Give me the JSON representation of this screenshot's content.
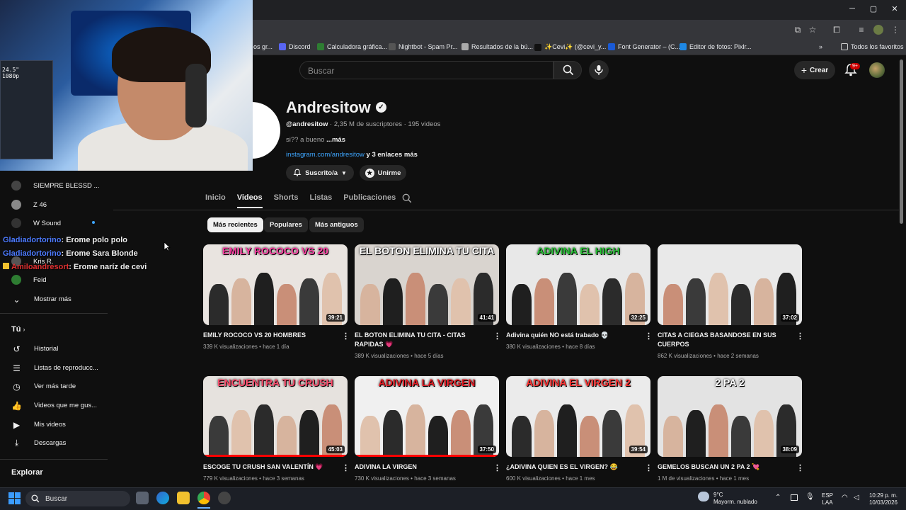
{
  "browser": {
    "bookmarks": [
      {
        "label": "os gr...",
        "color": "#888888"
      },
      {
        "label": "Discord",
        "color": "#5865f2"
      },
      {
        "label": "Calculadora gráfica...",
        "color": "#2e7d32"
      },
      {
        "label": "Nightbot - Spam Pr...",
        "color": "#555555"
      },
      {
        "label": "Resultados de la bú...",
        "color": "#aaaaaa"
      },
      {
        "label": "✨Cevi✨ (@cevi_y...",
        "color": "#111111"
      },
      {
        "label": "Font Generator – (C...",
        "color": "#1a5ad6"
      },
      {
        "label": "Editor de fotos: Pixlr...",
        "color": "#1e88e5"
      }
    ],
    "bookmarks_more": "»",
    "all_bookmarks": "Todos los favoritos",
    "window_min": "─",
    "window_max": "▢",
    "window_close": "✕"
  },
  "header": {
    "search_placeholder": "Buscar",
    "create_label": "Crear",
    "notifications_badge": "9+"
  },
  "channel": {
    "name": "Andresitow",
    "handle": "@andresitow",
    "subscribers": "2,35 M de suscriptores",
    "video_count": "195 videos",
    "meta_sep": " · ",
    "description": "si?? a bueno",
    "more": "...más",
    "link": "instagram.com/andresitow",
    "link_more": " y 3 enlaces más",
    "subscribed_label": "Suscrito/a",
    "join_label": "Unirme"
  },
  "tabs": [
    {
      "label": "Inicio",
      "active": false
    },
    {
      "label": "Videos",
      "active": true
    },
    {
      "label": "Shorts",
      "active": false
    },
    {
      "label": "Listas",
      "active": false
    },
    {
      "label": "Publicaciones",
      "active": false
    }
  ],
  "chips": [
    {
      "label": "Más recientes",
      "active": true
    },
    {
      "label": "Populares",
      "active": false
    },
    {
      "label": "Más antiguos",
      "active": false
    }
  ],
  "videos": [
    {
      "thumb_text": "EMILY ROCOCO VS 20",
      "thumb_bg": "#e9e4e0",
      "text_color": "#ff3fa4",
      "duration": "39:21",
      "title": "EMILY ROCOCO VS 20 HOMBRES",
      "views": "339 K visualizaciones",
      "age": "hace 1 día",
      "progress": 0.0
    },
    {
      "thumb_text": "EL BOTON ELIMINA TU CITA",
      "thumb_bg": "#d9d4cf",
      "text_color": "#ffffff",
      "duration": "41:41",
      "title": "EL BOTON ELIMINA TU CITA - CITAS RAPIDAS 💗",
      "views": "389 K visualizaciones",
      "age": "hace 5 días",
      "progress": 0.0
    },
    {
      "thumb_text": "ADIVINA EL HIGH",
      "thumb_bg": "#e8e8e8",
      "text_color": "#27c235",
      "duration": "32:25",
      "title": "Adivina quién NO está trabado 💀",
      "views": "380 K visualizaciones",
      "age": "hace 8 días",
      "progress": 0.0
    },
    {
      "thumb_text": "",
      "thumb_bg": "#e9e9e9",
      "text_color": "#ffffff",
      "duration": "37:02",
      "title": "CITAS A CIEGAS BASANDOSE EN SUS CUERPOS",
      "views": "862 K visualizaciones",
      "age": "hace 2 semanas",
      "progress": 0.0
    },
    {
      "thumb_text": "ENCUENTRA TU CRUSH",
      "thumb_bg": "#e6e2de",
      "text_color": "#ff4d6d",
      "duration": "45:03",
      "title": "ESCOGE TU CRUSH SAN VALENTÍN 💗",
      "views": "779 K visualizaciones",
      "age": "hace 3 semanas",
      "progress": 1.0
    },
    {
      "thumb_text": "ADIVINA LA VIRGEN",
      "thumb_bg": "#f0f0f0",
      "text_color": "#e31b23",
      "duration": "37:50",
      "title": "ADIVINA LA VIRGEN",
      "views": "730 K visualizaciones",
      "age": "hace 3 semanas",
      "progress": 1.0
    },
    {
      "thumb_text": "ADIVINA EL VIRGEN 2",
      "thumb_bg": "#ebebeb",
      "text_color": "#ff3333",
      "duration": "39:54",
      "title": "¿ADIVINA QUIEN ES EL VIRGEN? 😂",
      "views": "600 K visualizaciones",
      "age": "hace 1 mes",
      "progress": 0.0
    },
    {
      "thumb_text": "2 PA 2",
      "thumb_bg": "#e3e3e3",
      "text_color": "#ffffff",
      "duration": "38:09",
      "title": "GEMELOS BUSCAN UN 2 PA 2 💘",
      "views": "1 M de visualizaciones",
      "age": "hace 1 mes",
      "progress": 0.0
    }
  ],
  "meta_dot": " • ",
  "webcam": {
    "monitor_text": "24.5\"\n1080p"
  },
  "sidebar": {
    "subs": [
      {
        "label": "SIEMPRE BLESSD ...",
        "color": "#444444",
        "dot": false
      },
      {
        "label": "Z 46",
        "color": "#888888",
        "dot": false
      },
      {
        "label": "W Sound",
        "color": "#333333",
        "dot": true
      },
      {
        "label": "Kris R.",
        "color": "#555555",
        "dot": false
      },
      {
        "label": "Feid",
        "color": "#2e7d32",
        "dot": false
      }
    ],
    "show_more": "Mostrar más",
    "you_label": "Tú",
    "you_items": [
      {
        "label": "Historial",
        "icon": "history-icon"
      },
      {
        "label": "Listas de reproducc...",
        "icon": "playlists-icon"
      },
      {
        "label": "Ver más tarde",
        "icon": "watch-later-icon"
      },
      {
        "label": "Videos que me gus...",
        "icon": "like-icon"
      },
      {
        "label": "Mis videos",
        "icon": "my-videos-icon"
      },
      {
        "label": "Descargas",
        "icon": "download-icon"
      }
    ],
    "explore_label": "Explorar"
  },
  "chat": [
    {
      "user": "Gladiadortorino",
      "msg": ": Erome polo polo",
      "red": false
    },
    {
      "user": "Gladiadortorino",
      "msg": ": Erome Sara Blonde",
      "red": false
    },
    {
      "user": "Amiloandresort",
      "msg": ": Erome naríz de cevi",
      "red": true
    }
  ],
  "taskbar": {
    "search_label": "Buscar",
    "weather_temp": "9°C",
    "weather_desc": "Mayorm. nublado",
    "lang": "ESP",
    "lang2": "LAA",
    "time": "10:29 p. m.",
    "date": "10/03/2026"
  }
}
